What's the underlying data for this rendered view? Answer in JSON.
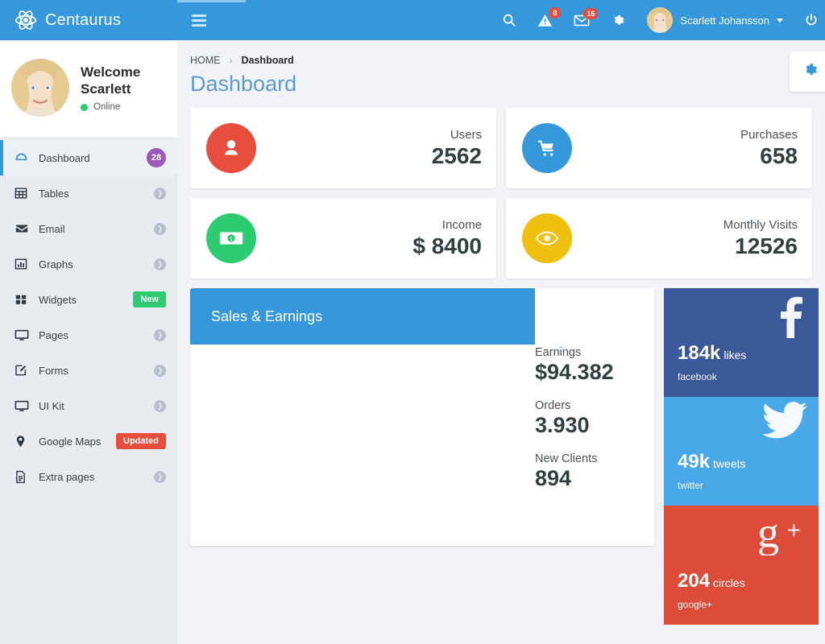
{
  "brand": {
    "name": "Centaurus",
    "logo_icon": "atom-icon"
  },
  "sidebar": {
    "profile": {
      "welcome": "Welcome Scarlett",
      "status": "Online",
      "avatar_icon": "user-avatar"
    },
    "items": [
      {
        "label": "Dashboard",
        "icon": "speedometer-icon",
        "badge": "28",
        "badge_type": "round",
        "active": true
      },
      {
        "label": "Tables",
        "icon": "table-icon",
        "badge": "",
        "badge_type": "chevron",
        "active": false
      },
      {
        "label": "Email",
        "icon": "envelope-icon",
        "badge": "",
        "badge_type": "chevron",
        "active": false
      },
      {
        "label": "Graphs",
        "icon": "bar-chart-icon",
        "badge": "",
        "badge_type": "chevron",
        "active": false
      },
      {
        "label": "Widgets",
        "icon": "grid-icon",
        "badge": "New",
        "badge_type": "new",
        "active": false
      },
      {
        "label": "Pages",
        "icon": "monitor-icon",
        "badge": "",
        "badge_type": "chevron",
        "active": false
      },
      {
        "label": "Forms",
        "icon": "edit-icon",
        "badge": "",
        "badge_type": "chevron",
        "active": false
      },
      {
        "label": "UI Kit",
        "icon": "monitor-icon",
        "badge": "",
        "badge_type": "chevron",
        "active": false
      },
      {
        "label": "Google Maps",
        "icon": "map-pin-icon",
        "badge": "Updated",
        "badge_type": "updated",
        "active": false
      },
      {
        "label": "Extra pages",
        "icon": "document-icon",
        "badge": "",
        "badge_type": "chevron",
        "active": false
      }
    ]
  },
  "topbar": {
    "menu_toggle_icon": "hamburger-icon",
    "search_icon": "search-icon",
    "alerts": {
      "icon": "warning-triangle-icon",
      "badge": "8"
    },
    "messages": {
      "icon": "envelope-icon",
      "badge": "16"
    },
    "settings_icon": "gear-icon",
    "user_name": "Scarlett Johansson",
    "user_caret_icon": "caret-down-icon",
    "power_icon": "power-icon"
  },
  "breadcrumb": {
    "home": "HOME",
    "separator": "›",
    "current": "Dashboard"
  },
  "page": {
    "title": "Dashboard",
    "settings_fab_icon": "gear-icon"
  },
  "stats": [
    {
      "label": "Users",
      "value": "2562",
      "icon": "user-icon",
      "color": "#e74c3c"
    },
    {
      "label": "Purchases",
      "value": "658",
      "icon": "cart-icon",
      "color": "#3498db"
    },
    {
      "label": "Income",
      "value": "$ 8400",
      "icon": "money-bill-icon",
      "color": "#2ecc71"
    },
    {
      "label": "Monthly Visits",
      "value": "12526",
      "icon": "eye-icon",
      "color": "#f0c010"
    }
  ],
  "sales_panel": {
    "title": "Sales & Earnings",
    "metrics": [
      {
        "label": "Earnings",
        "value": "$94.382"
      },
      {
        "label": "Orders",
        "value": "3.930"
      },
      {
        "label": "New Clients",
        "value": "894"
      }
    ]
  },
  "social": [
    {
      "network": "facebook",
      "count": "184k",
      "unit": "likes",
      "icon": "facebook-icon",
      "color": "#3b5998"
    },
    {
      "network": "twitter",
      "count": "49k",
      "unit": "tweets",
      "icon": "twitter-icon",
      "color": "#48a8e8"
    },
    {
      "network": "google+",
      "count": "204",
      "unit": "circles",
      "icon": "googleplus-icon",
      "color": "#dd4b39"
    }
  ]
}
